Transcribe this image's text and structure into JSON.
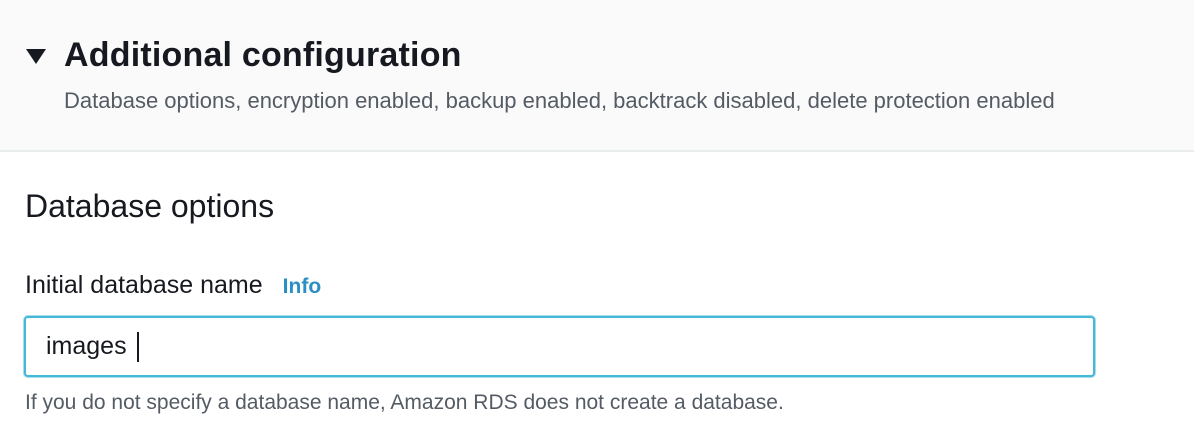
{
  "section": {
    "title": "Additional configuration",
    "expanded": true,
    "description": "Database options, encryption enabled, backup enabled, backtrack disabled, delete protection enabled"
  },
  "database_options": {
    "heading": "Database options",
    "initial_db_name": {
      "label": "Initial database name",
      "info_link": "Info",
      "value": "images",
      "constraint": "If you do not specify a database name, Amazon RDS does not create a database."
    }
  },
  "colors": {
    "accent_link": "#2b8fc4",
    "focus_border": "#44b9d6",
    "header_bg": "#fafafa"
  }
}
